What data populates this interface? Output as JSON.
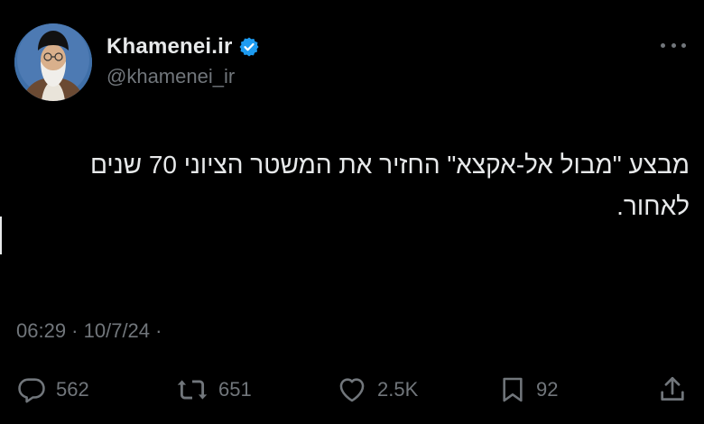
{
  "author": {
    "display_name": "Khamenei.ir",
    "handle": "@khamenei_ir",
    "verified": true,
    "avatar_icon": "profile-portrait-icon"
  },
  "tweet": {
    "text": "מבצע \"מבול אל-אקצא\" החזיר את המשטר הציוני 70 שנים\nלאחור.",
    "time": "06:29",
    "separator": " · ",
    "date": "10/7/24",
    "trailing_separator": " ·"
  },
  "actions": {
    "replies": "562",
    "reposts": "651",
    "likes": "2.5K",
    "bookmarks": "92"
  },
  "colors": {
    "background": "#000000",
    "primary_text": "#e7e9ea",
    "secondary_text": "#71767b",
    "verified_badge": "#1d9bf0"
  },
  "icons": [
    "more-icon",
    "verified-badge-icon",
    "reply-icon",
    "repost-icon",
    "like-icon",
    "bookmark-icon",
    "share-icon"
  ]
}
